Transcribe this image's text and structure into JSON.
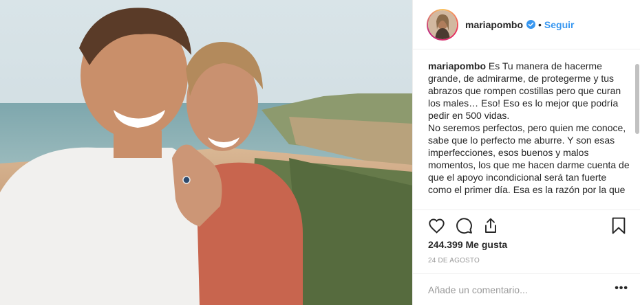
{
  "post": {
    "photo_icon": "couple-selfie-photo",
    "header": {
      "username": "mariapombo",
      "separator": "•",
      "follow_label": "Seguir",
      "verified_icon": "verified-badge-icon"
    },
    "caption": {
      "username": "mariapombo",
      "lines": [
        "Es Tu manera de hacerme grande, de admirarme, de protegerme y tus abrazos que rompen costillas pero que curan los males… Eso! Eso es lo mejor que podría pedir en 500 vidas.",
        "No seremos perfectos, pero quien me conoce, sabe que lo perfecto me aburre. Y son esas imperfecciones, esos buenos y malos momentos, los que me hacen darme cuenta de que el apoyo incondicional será tan fuerte como el primer día. Esa es la razón por la que"
      ]
    },
    "likes_text": "244.399 Me gusta",
    "date": "24 DE AGOSTO",
    "comment_placeholder": "Añade un comentario...",
    "more_label": "•••",
    "colors": {
      "accent": "#3897f0",
      "text": "#262626",
      "muted": "#999999",
      "border": "#efefef"
    }
  }
}
